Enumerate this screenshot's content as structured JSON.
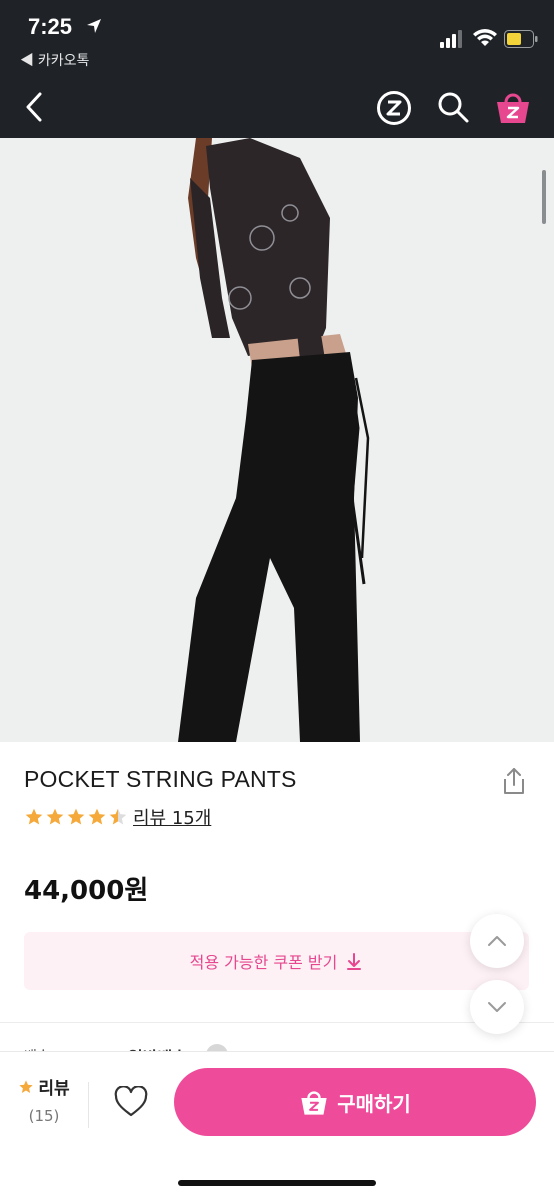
{
  "status_bar": {
    "time": "7:25",
    "back_app": "◀ 카카오톡"
  },
  "nav": {
    "back_icon": "chevron-left-icon",
    "z_icon": "zigzag-z-icon",
    "search_icon": "search-icon",
    "cart_icon": "shopping-basket-icon",
    "accent_color": "#e6478f"
  },
  "product": {
    "title": "POCKET STRING PANTS",
    "rating": 4.5,
    "rating_max": 5,
    "review_link": "리뷰 15개",
    "price": "44,000원"
  },
  "coupon": {
    "label": "적용 가능한 쿠폰 받기"
  },
  "shipping": {
    "label": "배송",
    "value": "일반배송"
  },
  "bottom_bar": {
    "review_label": "리뷰",
    "review_count": "(15)",
    "buy_label": "구매하기",
    "buy_color": "#ee4b9b"
  }
}
